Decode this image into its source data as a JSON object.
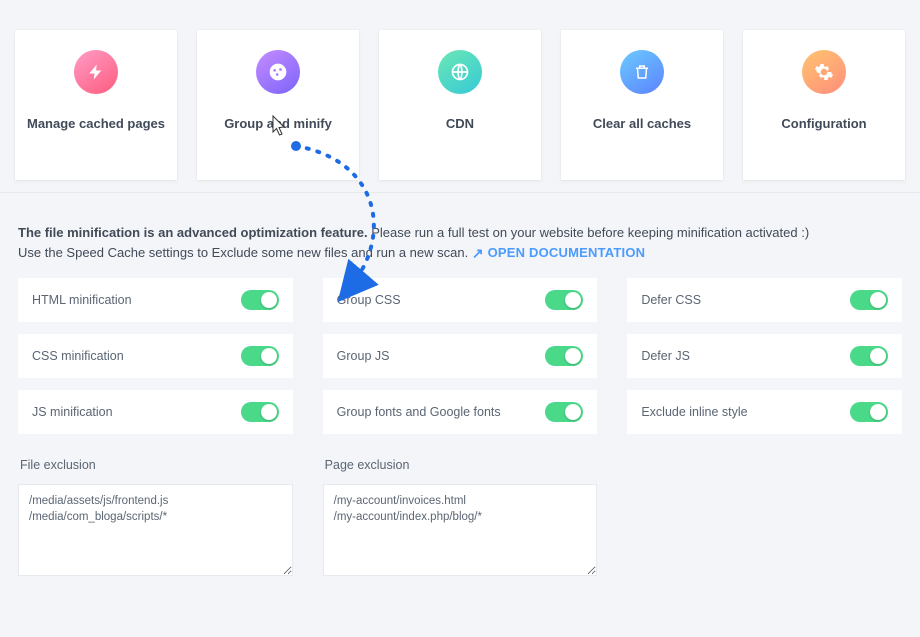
{
  "nav": {
    "items": [
      {
        "label": "Manage cached pages",
        "icon": "bolt-icon",
        "gradient": "g-pink"
      },
      {
        "label": "Group and minify",
        "icon": "palette-icon",
        "gradient": "g-purple"
      },
      {
        "label": "CDN",
        "icon": "globe-icon",
        "gradient": "g-teal"
      },
      {
        "label": "Clear all caches",
        "icon": "trash-icon",
        "gradient": "g-blue"
      },
      {
        "label": "Configuration",
        "icon": "gear-icon",
        "gradient": "g-orange"
      }
    ]
  },
  "notice": {
    "line1a": "The file minification is an advanced optimization feature.",
    "line1b": " Please run a full test on your website before keeping minification activated :)",
    "line2": "Use the Speed Cache settings to Exclude some new files and run a new scan.",
    "doc_label": "OPEN DOCUMENTATION"
  },
  "settings": {
    "col1": [
      {
        "label": "HTML minification",
        "on": true
      },
      {
        "label": "CSS minification",
        "on": true
      },
      {
        "label": "JS minification",
        "on": true
      }
    ],
    "col2": [
      {
        "label": "Group CSS",
        "on": true
      },
      {
        "label": "Group JS",
        "on": true
      },
      {
        "label": "Group fonts and Google fonts",
        "on": true
      }
    ],
    "col3": [
      {
        "label": "Defer CSS",
        "on": true
      },
      {
        "label": "Defer JS",
        "on": true
      },
      {
        "label": "Exclude inline style",
        "on": true
      }
    ]
  },
  "exclusion": {
    "file": {
      "title": "File exclusion",
      "value": "/media/assets/js/frontend.js\n/media/com_bloga/scripts/*"
    },
    "page": {
      "title": "Page exclusion",
      "value": "/my-account/invoices.html\n/my-account/index.php/blog/*"
    }
  }
}
